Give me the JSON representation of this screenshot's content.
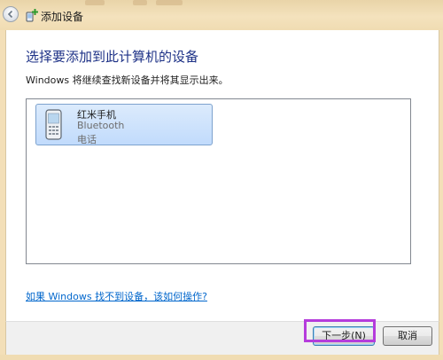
{
  "window": {
    "title": "添加设备"
  },
  "main": {
    "heading": "选择要添加到此计算机的设备",
    "subtext": "Windows 将继续查找新设备并将其显示出来。",
    "help_link": "如果 Windows 找不到设备，该如何操作?"
  },
  "devices": [
    {
      "name": "红米手机",
      "connection": "Bluetooth",
      "category": "电话",
      "icon": "mobile-phone-icon",
      "selected": true
    }
  ],
  "footer": {
    "next_label": "下一步(N)",
    "cancel_label": "取消"
  },
  "colors": {
    "heading": "#1e3287",
    "link": "#0066cc",
    "selection": "#c1dbfc",
    "highlight_annotation": "#b53cdc"
  }
}
